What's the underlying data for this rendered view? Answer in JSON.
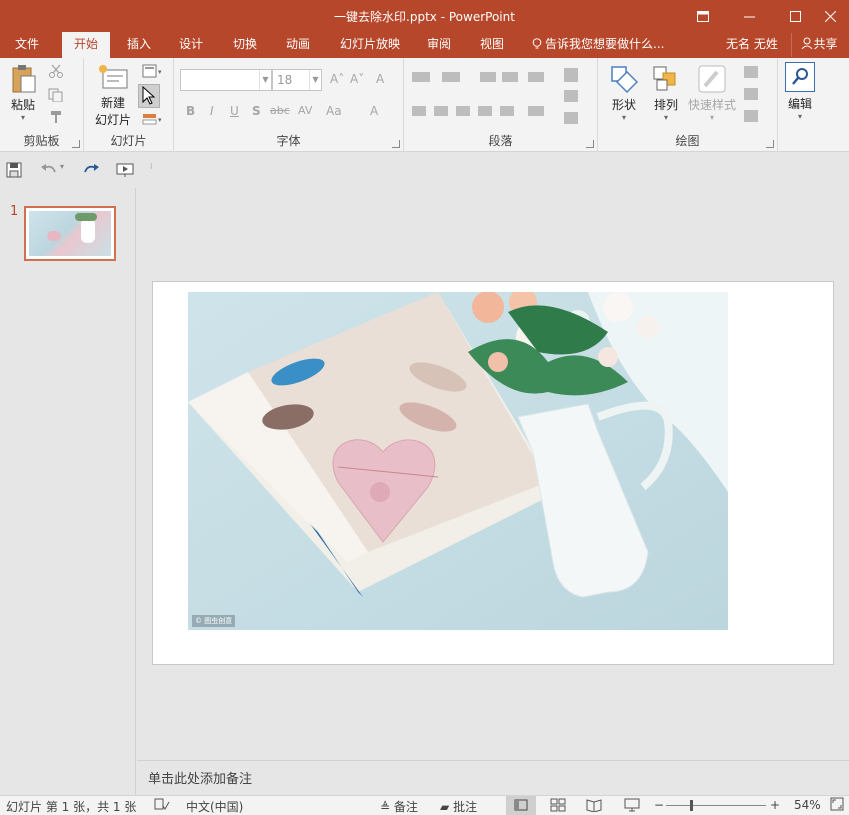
{
  "window": {
    "title": "一键去除水印.pptx - PowerPoint",
    "controls": [
      "▣",
      "—",
      "☐",
      "✕"
    ]
  },
  "tabs": [
    {
      "label": "文件"
    },
    {
      "label": "开始"
    },
    {
      "label": "插入"
    },
    {
      "label": "设计"
    },
    {
      "label": "切换"
    },
    {
      "label": "动画"
    },
    {
      "label": "幻灯片放映"
    },
    {
      "label": "审阅"
    },
    {
      "label": "视图"
    }
  ],
  "tellme": "告诉我您想要做什么...",
  "user": "无名 无姓",
  "share": "共享",
  "ribbon": {
    "clipboard": {
      "paste": "粘贴",
      "label": "剪贴板"
    },
    "slides": {
      "new_slide_line1": "新建",
      "new_slide_line2": "幻灯片",
      "label": "幻灯片"
    },
    "font": {
      "font_name": "",
      "font_size": "18",
      "label": "字体",
      "bold": "B",
      "italic": "I",
      "underline": "U",
      "shadow": "S",
      "strike": "abc",
      "spacing": "AV",
      "case": "Aa",
      "color": "A",
      "grow": "A˄",
      "shrink": "A˅",
      "clear": "A"
    },
    "paragraph": {
      "label": "段落"
    },
    "drawing": {
      "shapes": "形状",
      "arrange": "排列",
      "quick_styles": "快速样式",
      "label": "绘图"
    },
    "editing": {
      "edit": "编辑"
    }
  },
  "slide_pane": {
    "slide_number": "1"
  },
  "slide": {
    "watermark": "© 图虫创意"
  },
  "notes_placeholder": "单击此处添加备注",
  "status": {
    "slide_info": "幻灯片 第 1 张，共 1 张",
    "language": "中文(中国)",
    "notes": "备注",
    "comments": "批注",
    "zoom": "54%"
  },
  "colors": {
    "accent": "#b7472a",
    "ribbon_bg": "#f3f3f3",
    "canvas_bg": "#e6e6e6"
  }
}
